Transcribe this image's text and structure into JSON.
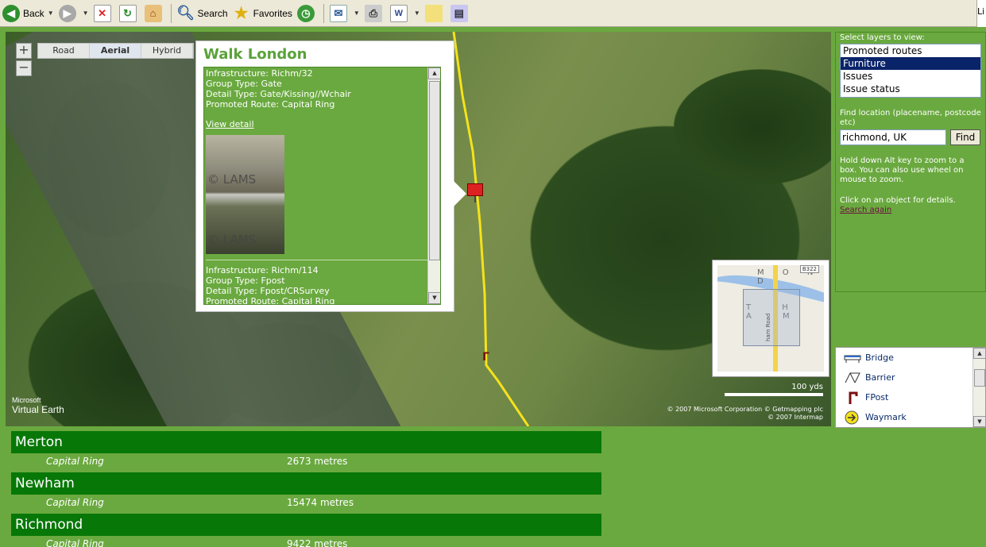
{
  "toolbar": {
    "back_label": "Back",
    "search_label": "Search",
    "favorites_label": "Favorites",
    "right_edge_text": "Li"
  },
  "map": {
    "tabs": [
      {
        "label": "Road",
        "active": false
      },
      {
        "label": "Aerial",
        "active": true
      },
      {
        "label": "Hybrid",
        "active": false
      }
    ],
    "zoom_in": "+",
    "zoom_out": "−",
    "logo_small": "Microsoft",
    "logo_big": "Virtual Earth",
    "scale_label": "100 yds",
    "copyright_line1": "© 2007 Microsoft Corporation  © Getmapping plc",
    "copyright_line2": "© 2007 Intermap",
    "minimap_text1": "M O N D",
    "minimap_text2": "T H A M",
    "minimap_road_label": "B322",
    "minimap_street": "ham Road",
    "colors": {
      "route": "#f5e21a",
      "marker": "#dd2222"
    }
  },
  "popup": {
    "title": "Walk London",
    "item1": {
      "infrastructure": "Infrastructure: Richm/32",
      "group_type": "Group Type: Gate",
      "detail_type": "Detail Type: Gate/Kissing//Wchair",
      "promoted_route": "Promoted Route: Capital Ring",
      "view_detail": "View detail",
      "photo_watermark": "© LAMS"
    },
    "item2": {
      "infrastructure": "Infrastructure: Richm/114",
      "group_type": "Group Type: Fpost",
      "detail_type": "Detail Type: Fpost/CRSurvey",
      "promoted_route": "Promoted Route: Capital Ring"
    }
  },
  "panel": {
    "layers_label": "Select layers to view:",
    "layers": [
      {
        "label": "Promoted routes",
        "selected": false
      },
      {
        "label": "Furniture",
        "selected": true
      },
      {
        "label": "Issues",
        "selected": false
      },
      {
        "label": "Issue status",
        "selected": false
      }
    ],
    "find_label": "Find location (placename, postcode etc)",
    "find_value": "richmond, UK",
    "find_button": "Find",
    "help1": "Hold down Alt key to zoom to a box. You can also use wheel on mouse to zoom.",
    "help2": "Click on an object for details.",
    "search_again": "Search again"
  },
  "legend": {
    "items": [
      {
        "label": "Bridge",
        "icon": "bridge-icon"
      },
      {
        "label": "Barrier",
        "icon": "barrier-icon"
      },
      {
        "label": "FPost",
        "icon": "fpost-icon"
      },
      {
        "label": "Waymark",
        "icon": "waymark-icon"
      }
    ]
  },
  "results": [
    {
      "borough": "Merton",
      "route": "Capital Ring",
      "distance": "2673 metres"
    },
    {
      "borough": "Newham",
      "route": "Capital Ring",
      "distance": "15474 metres"
    },
    {
      "borough": "Richmond",
      "route": "Capital Ring",
      "distance": "9422 metres"
    }
  ]
}
